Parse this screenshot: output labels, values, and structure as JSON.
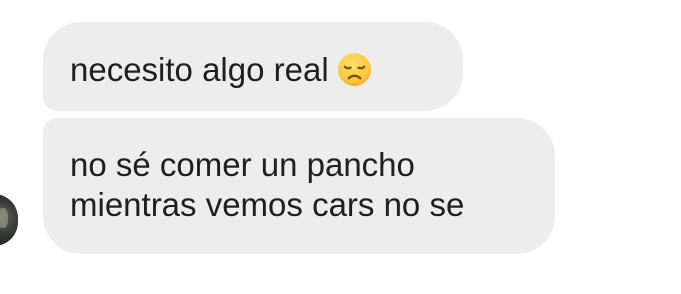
{
  "messages": [
    {
      "text": "necesito algo real",
      "emoji": "disappointed-face-icon"
    },
    {
      "text": "no sé comer un pancho\nmientras vemos cars no se"
    }
  ],
  "colors": {
    "bubble_bg": "#ededed",
    "text": "#1f1f1f",
    "emoji_face": "#ffc93c"
  }
}
